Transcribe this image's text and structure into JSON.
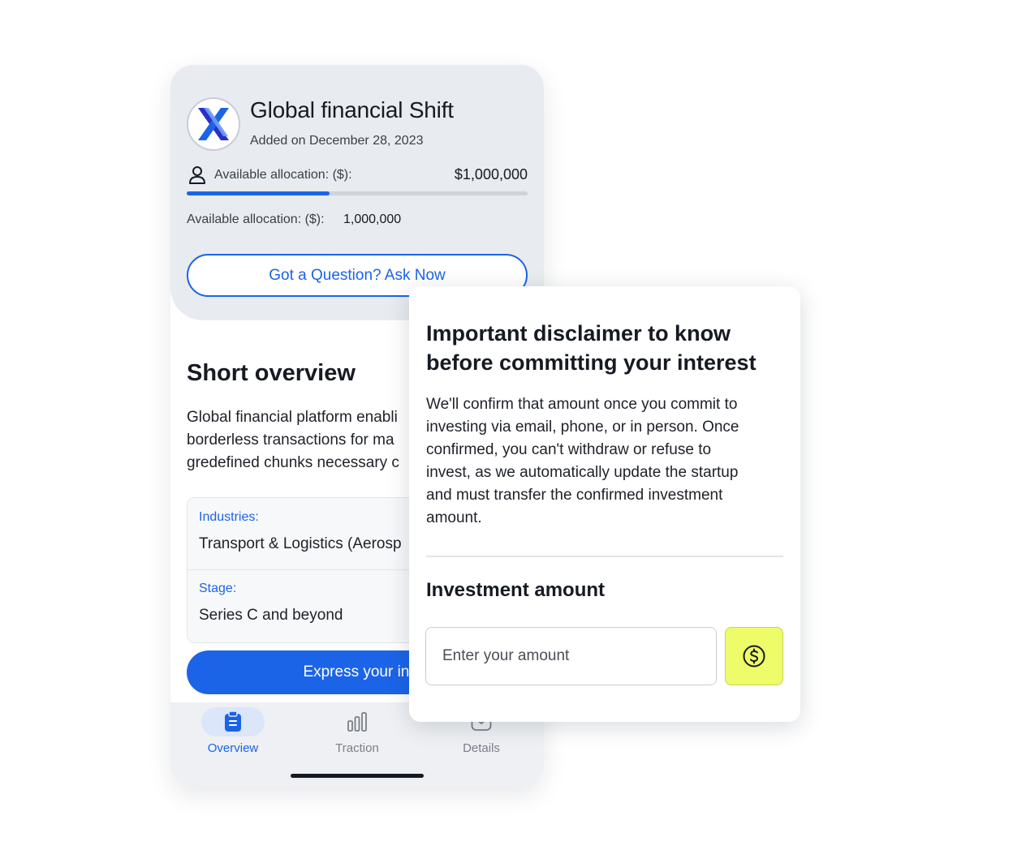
{
  "company": {
    "name": "Global financial Shift",
    "added_on": "Added on December 28, 2023",
    "logo_icon": "x-logo-icon"
  },
  "allocation": {
    "label": "Available allocation: ($):",
    "amount": "$1,000,000",
    "progress_fraction": 0.42,
    "line_label": "Available allocation: ($):",
    "line_value": "1,000,000"
  },
  "ask_button": {
    "label": "Got a Question? Ask Now"
  },
  "overview": {
    "title": "Short overview",
    "text": "Global financial platform enabli\nborderless transactions for ma\ngredefined chunks necessary c"
  },
  "info": [
    {
      "label": "Industries:",
      "value": "Transport & Logistics  (Aerosp"
    },
    {
      "label": "Stage:",
      "value": "Series C and beyond"
    }
  ],
  "express_button": {
    "label": "Express your inter"
  },
  "nav": [
    {
      "label": "Overview",
      "icon": "clipboard-icon",
      "active": true
    },
    {
      "label": "Traction",
      "icon": "bar-chart-icon",
      "active": false
    },
    {
      "label": "Details",
      "icon": "details-icon",
      "active": false
    }
  ],
  "modal": {
    "title": "Important disclaimer to know\nbefore committing your interest",
    "text": "We'll confirm that amount once you commit to\ninvesting via email, phone, or in person. Once\nconfirmed, you can't withdraw or refuse to\ninvest, as we automatically update the startup\nand must transfer the confirmed investment\namount.",
    "amount_title": "Investment amount",
    "amount_placeholder": "Enter your amount",
    "currency_icon": "dollar-circle-icon"
  },
  "colors": {
    "primary": "#1b64e8",
    "panel": "#e8ebef",
    "accent_lime": "#eefc6a",
    "text": "#161a22"
  }
}
